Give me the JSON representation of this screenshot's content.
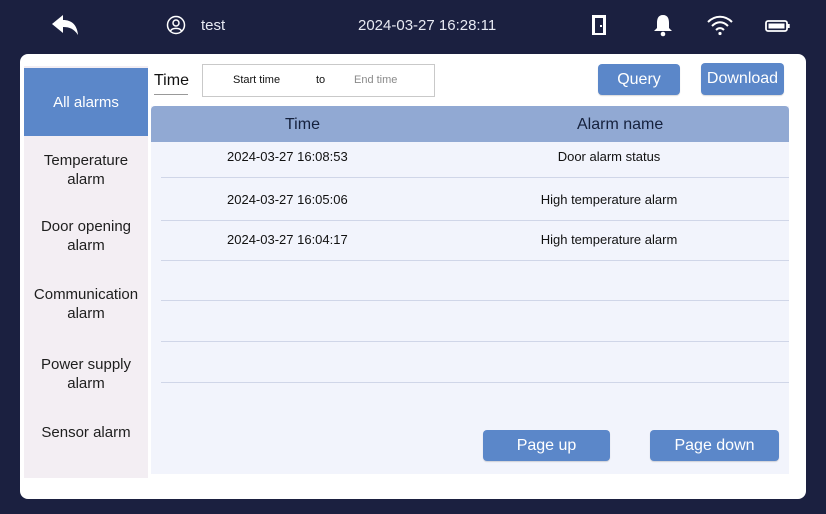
{
  "status_bar": {
    "user_name": "test",
    "datetime": "2024-03-27 16:28:11",
    "icons": [
      "back-arrow-icon",
      "user-icon",
      "door-icon",
      "bell-icon",
      "wifi-icon",
      "battery-icon"
    ]
  },
  "sidebar": {
    "items": [
      {
        "label_line1": "All alarms",
        "label_line2": "",
        "active": true
      },
      {
        "label_line1": "Temperature",
        "label_line2": "alarm",
        "active": false
      },
      {
        "label_line1": "Door opening",
        "label_line2": "alarm",
        "active": false
      },
      {
        "label_line1": "Communication",
        "label_line2": "alarm",
        "active": false
      },
      {
        "label_line1": "Power supply",
        "label_line2": "alarm",
        "active": false
      },
      {
        "label_line1": "Sensor alarm",
        "label_line2": "",
        "active": false
      }
    ]
  },
  "filter": {
    "time_label": "Time",
    "start_placeholder": "Start time",
    "to_label": "to",
    "end_placeholder": "End time",
    "query_label": "Query",
    "download_label": "Download"
  },
  "table": {
    "columns": [
      "Time",
      "Alarm name"
    ],
    "rows": [
      {
        "time": "2024-03-27 16:08:53",
        "name": "Door alarm status"
      },
      {
        "time": "2024-03-27 16:05:06",
        "name": "High temperature alarm"
      },
      {
        "time": "2024-03-27 16:04:17",
        "name": "High temperature alarm"
      },
      {
        "time": "",
        "name": ""
      },
      {
        "time": "",
        "name": ""
      },
      {
        "time": "",
        "name": ""
      }
    ]
  },
  "pagination": {
    "page_up_label": "Page up",
    "page_down_label": "Page down"
  },
  "colors": {
    "background": "#1b2040",
    "accent": "#5b87c9",
    "table_header": "#91a9d3",
    "sidebar_bg": "#f3eef3",
    "content_bg": "#f2f4fc"
  }
}
